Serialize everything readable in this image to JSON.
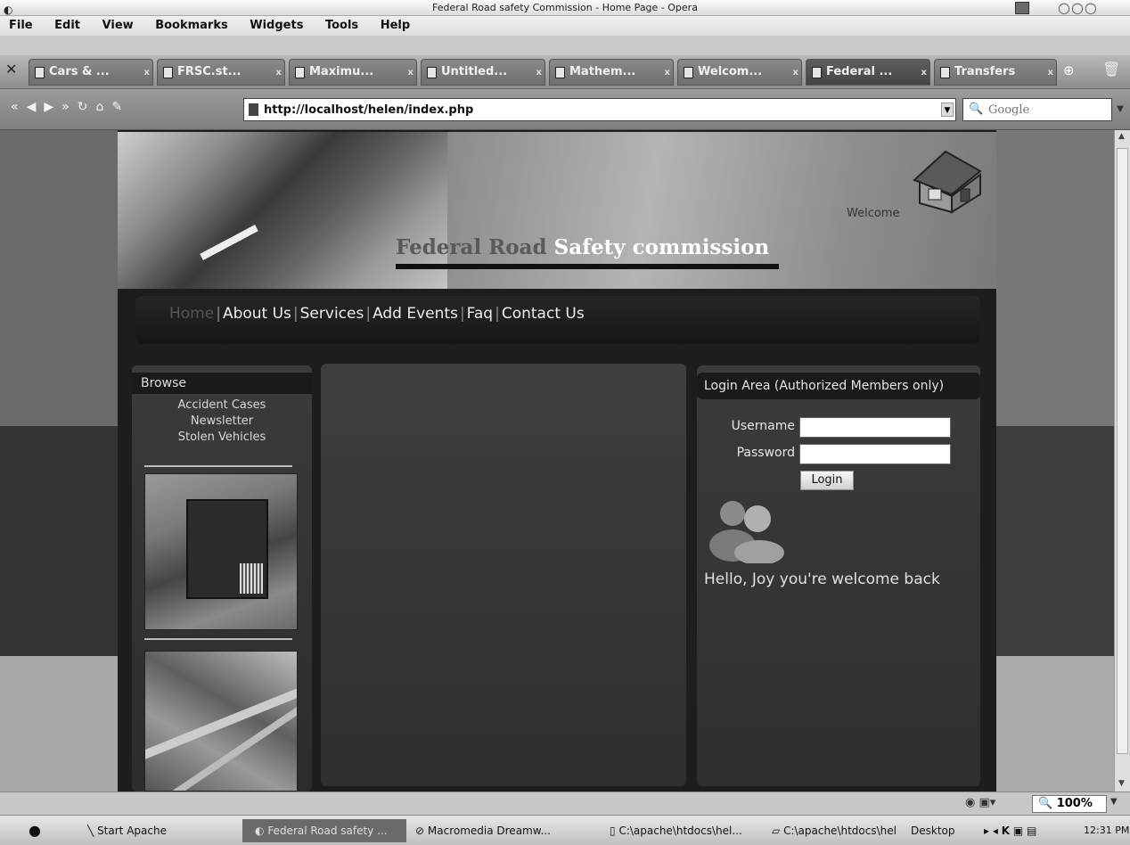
{
  "window": {
    "title": "Federal Road safety Commission - Home Page - Opera"
  },
  "menubar": {
    "items": [
      "File",
      "Edit",
      "View",
      "Bookmarks",
      "Widgets",
      "Tools",
      "Help"
    ]
  },
  "tabs": [
    {
      "label": "Cars & ..."
    },
    {
      "label": "FRSC.st..."
    },
    {
      "label": "Maximu..."
    },
    {
      "label": "Untitled..."
    },
    {
      "label": "Mathem..."
    },
    {
      "label": "Welcom..."
    },
    {
      "label": "Federal ..."
    },
    {
      "label": "Transfers"
    }
  ],
  "address": {
    "url": "http://localhost/helen/index.php"
  },
  "search": {
    "placeholder": "Google"
  },
  "site": {
    "welcome": "Welcome",
    "title_part1": "Federal Road",
    "title_part2": "Safety commission",
    "nav": {
      "home": "Home",
      "about": "About Us",
      "services": "Services",
      "events": "Add Events",
      "faq": "Faq",
      "contact": "Contact Us",
      "sep": "|"
    },
    "browse": {
      "heading": "Browse",
      "links": [
        "Accident Cases",
        "Newsletter",
        "Stolen Vehicles"
      ]
    },
    "login": {
      "heading": "Login Area (Authorized Members only)",
      "username_label": "Username",
      "password_label": "Password",
      "button": "Login",
      "greeting": "Hello, Joy you're welcome back"
    }
  },
  "statusbar": {
    "zoom": "100%"
  },
  "taskbar": {
    "apache": "Start Apache",
    "active": "Federal Road safety ...",
    "dreamweaver": "Macromedia Dreamw...",
    "folder1": "C:\\apache\\htdocs\\hel...",
    "folder2": "C:\\apache\\htdocs\\hel...",
    "desktop": "Desktop",
    "time": "12:31 PM"
  }
}
